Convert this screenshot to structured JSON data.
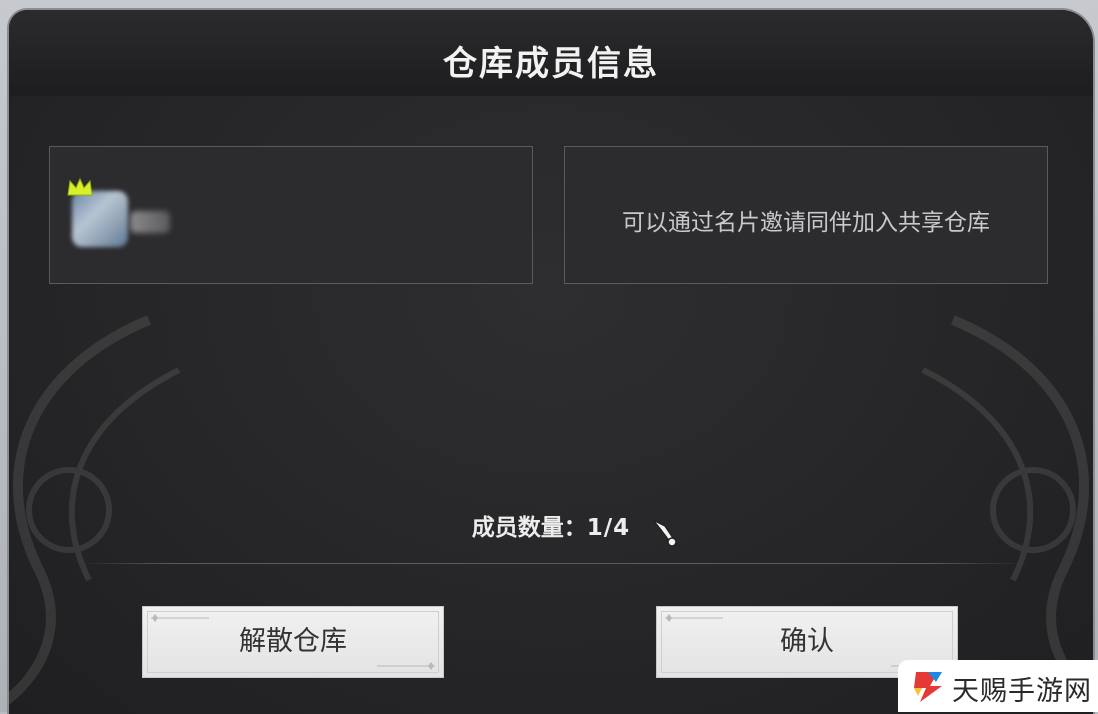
{
  "dialog": {
    "title": "仓库成员信息"
  },
  "members": {
    "owner": {
      "crown_icon": "crown-icon",
      "crown_color": "#d7f02a"
    },
    "invite_hint": "可以通过名片邀请同伴加入共享仓库"
  },
  "member_count": {
    "label": "成员数量：",
    "value": "1/4",
    "current": 1,
    "max": 4
  },
  "buttons": {
    "disband_label": "解散仓库",
    "confirm_label": "确认"
  },
  "watermark": {
    "text": "天赐手游网"
  },
  "colors": {
    "panel_bg": "#262628",
    "button_bg": "#ececec",
    "text_primary": "#f2f2f2",
    "text_secondary": "#c9c9cc"
  }
}
